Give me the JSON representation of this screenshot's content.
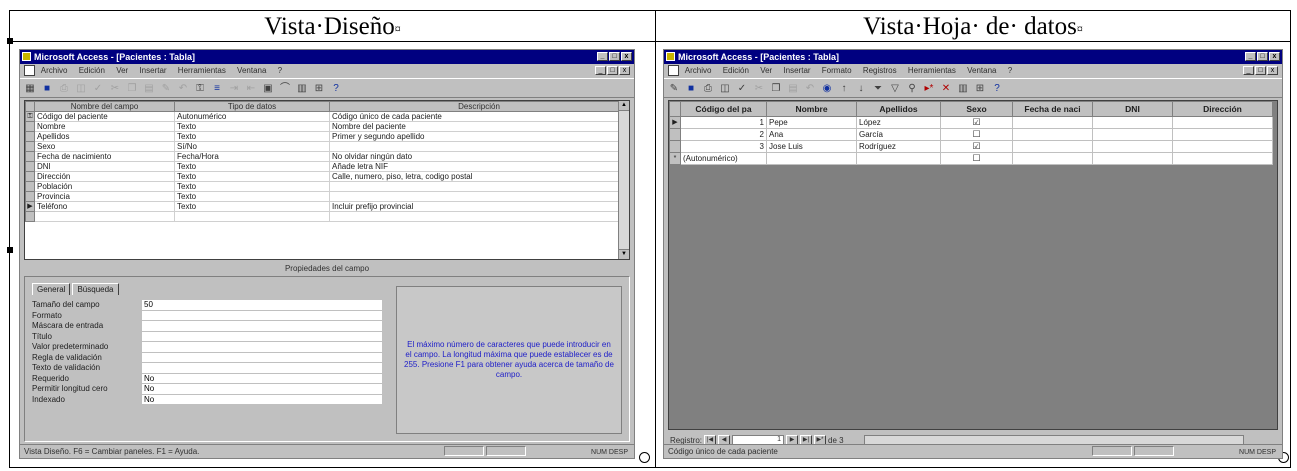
{
  "headings": {
    "design": "Vista·Diseño",
    "datasheet": "Vista·Hoja· de· datos"
  },
  "app": {
    "title": "Microsoft Access - [Pacientes : Tabla]",
    "title_buttons": [
      "_",
      "□",
      "x"
    ]
  },
  "design_view": {
    "menu": [
      "Archivo",
      "Edición",
      "Ver",
      "Insertar",
      "Herramientas",
      "Ventana",
      "?"
    ],
    "columns": [
      "Nombre del campo",
      "Tipo de datos",
      "Descripción"
    ],
    "rows": [
      [
        "Código del paciente",
        "Autonumérico",
        "Código único de cada paciente"
      ],
      [
        "Nombre",
        "Texto",
        "Nombre del paciente"
      ],
      [
        "Apellidos",
        "Texto",
        "Primer y segundo apellido"
      ],
      [
        "Sexo",
        "Sí/No",
        ""
      ],
      [
        "Fecha de nacimiento",
        "Fecha/Hora",
        "No olvidar ningún dato"
      ],
      [
        "DNI",
        "Texto",
        "Añade letra NIF"
      ],
      [
        "Dirección",
        "Texto",
        "Calle, numero, piso, letra, codigo postal"
      ],
      [
        "Población",
        "Texto",
        ""
      ],
      [
        "Provincia",
        "Texto",
        ""
      ],
      [
        "Teléfono",
        "Texto",
        "Incluir prefijo provincial"
      ]
    ],
    "properties_caption": "Propiedades del campo",
    "tabs": [
      "General",
      "Búsqueda"
    ],
    "properties": [
      [
        "Tamaño del campo",
        "50"
      ],
      [
        "Formato",
        ""
      ],
      [
        "Máscara de entrada",
        ""
      ],
      [
        "Título",
        ""
      ],
      [
        "Valor predeterminado",
        ""
      ],
      [
        "Regla de validación",
        ""
      ],
      [
        "Texto de validación",
        ""
      ],
      [
        "Requerido",
        "No"
      ],
      [
        "Permitir longitud cero",
        "No"
      ],
      [
        "Indexado",
        "No"
      ]
    ],
    "help_text": "El máximo número de caracteres que puede introducir en el campo. La longitud máxima que puede establecer es de 255. Presione F1 para obtener ayuda acerca de tamaño de campo.",
    "status": "Vista Diseño.  F6 = Cambiar paneles.  F1 = Ayuda.",
    "status_right": "NUM  DESP"
  },
  "datasheet_view": {
    "menu": [
      "Archivo",
      "Edición",
      "Ver",
      "Insertar",
      "Formato",
      "Registros",
      "Herramientas",
      "Ventana",
      "?"
    ],
    "columns": [
      "Código del pa",
      "Nombre",
      "Apellidos",
      "Sexo",
      "Fecha de naci",
      "DNI",
      "Dirección"
    ],
    "rows": [
      [
        "1",
        "Pepe",
        "López",
        "☑",
        "",
        "",
        ""
      ],
      [
        "2",
        "Ana",
        "García",
        "☐",
        "",
        "",
        ""
      ],
      [
        "3",
        "Jose Luis",
        "Rodríguez",
        "☑",
        "",
        "",
        ""
      ]
    ],
    "new_row": [
      "(Autonumérico)",
      "",
      "",
      "☐",
      "",
      "",
      ""
    ],
    "nav_label": "Registro:",
    "nav_current": "1",
    "nav_total": "de 3",
    "status": "Código único de cada paciente",
    "status_right": "NUM  DESP"
  }
}
